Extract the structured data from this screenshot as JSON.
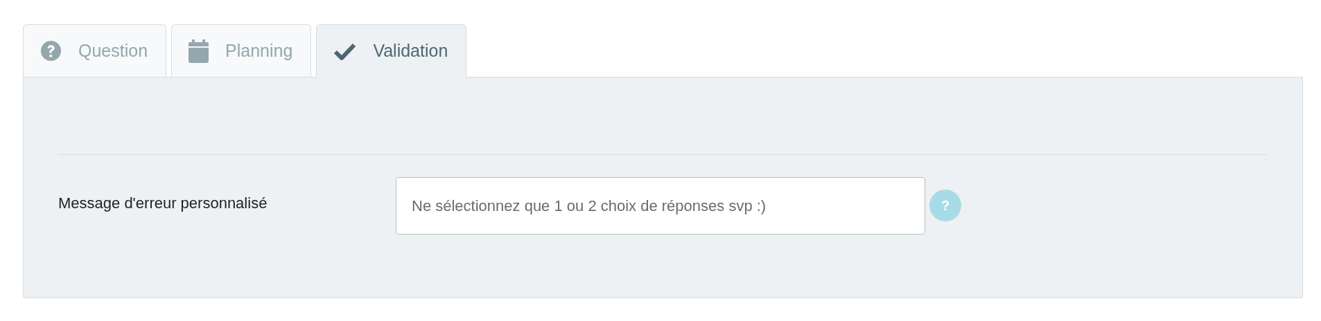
{
  "tabs": [
    {
      "label": "Question",
      "kind": "question",
      "selected": false
    },
    {
      "label": "Planning",
      "kind": "calendar",
      "selected": false
    },
    {
      "label": "Validation",
      "kind": "check",
      "selected": true
    }
  ],
  "form": {
    "label": "Message d'erreur personnalisé",
    "value": "Ne sélectionnez que 1 ou 2 choix de réponses svp :)",
    "help": "?"
  }
}
